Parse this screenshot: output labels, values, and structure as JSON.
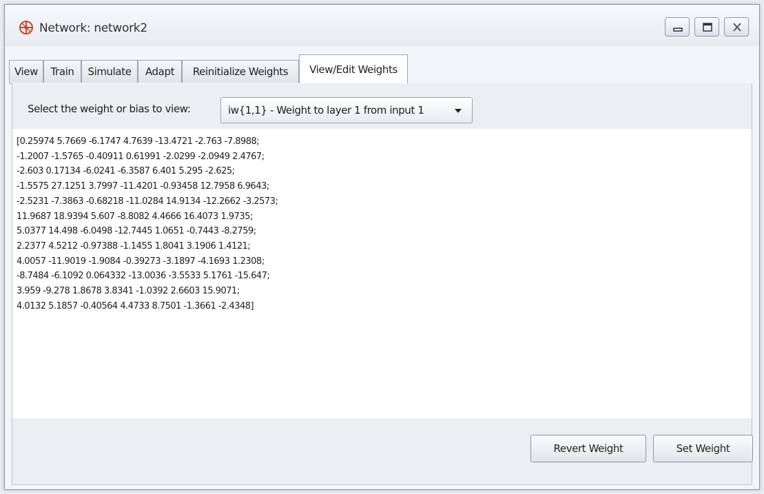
{
  "window": {
    "title": "Network: network2",
    "controls": [
      "minimize-icon",
      "maximize-icon",
      "close-icon"
    ]
  },
  "tabs": [
    {
      "label": "View",
      "active": false
    },
    {
      "label": "Train",
      "active": false
    },
    {
      "label": "Simulate",
      "active": false
    },
    {
      "label": "Adapt",
      "active": false
    },
    {
      "label": "Reinitialize Weights",
      "active": false
    },
    {
      "label": "View/Edit Weights",
      "active": true
    }
  ],
  "selector": {
    "label": "Select the weight or bias to view:",
    "selected": "iw{1,1} - Weight to layer 1 from input 1"
  },
  "matrix_lines": [
    "[0.25974 5.7669 -6.1747 4.7639 -13.4721 -2.763 -7.8988;",
    "-1.2007 -1.5765 -0.40911 0.61991 -2.0299 -2.0949 2.4767;",
    "-2.603 0.17134 -6.0241 -6.3587 6.401 5.295 -2.625;",
    "-1.5575 27.1251 3.7997 -11.4201 -0.93458 12.7958 6.9643;",
    "-2.5231 -7.3863 -0.68218 -11.0284 14.9134 -12.2662 -3.2573;",
    "11.9687 18.9394 5.607 -8.8082 4.4666 16.4073 1.9735;",
    "5.0377 14.498 -6.0498 -12.7445 1.0651 -0.7443 -8.2759;",
    "2.2377 4.5212 -0.97388 -1.1455 1.8041 3.1906 1.4121;",
    "4.0057 -11.9019 -1.9084 -0.39273 -3.1897 -4.1693 1.2308;",
    "-8.7484 -6.1092 0.064332 -13.0036 -3.5533 5.1761 -15.647;",
    "3.959 -9.278 1.8678 3.8341 -1.0392 2.6603 15.9071;",
    "4.0132 5.1857 -0.40564 4.4733 8.7501 -1.3661 -2.4348]"
  ],
  "buttons": {
    "revert": "Revert Weight",
    "set": "Set Weight"
  },
  "colors": {
    "accent_icon": "#c8472b",
    "panel_bg": "#eceef1",
    "editor_bg": "#ffffff"
  }
}
